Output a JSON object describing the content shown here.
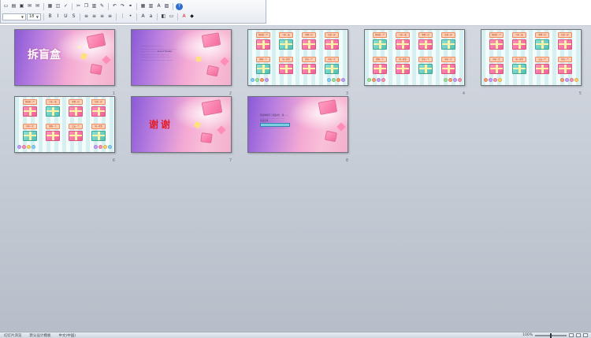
{
  "toolbar": {
    "font_size": "18",
    "row1_icons": [
      "new-icon",
      "open-icon",
      "save-icon",
      "permission-icon",
      "email-icon",
      "print-icon",
      "print-preview-icon",
      "spelling-icon",
      "cut-icon",
      "copy-icon",
      "paste-icon",
      "format-painter-icon",
      "undo-icon",
      "redo-icon",
      "hyperlink-icon",
      "table-icon",
      "chart-icon",
      "text-box-icon",
      "insert-picture-icon",
      "help-icon"
    ],
    "row2_icons": [
      "bold-icon",
      "italic-icon",
      "underline-icon",
      "shadow-icon",
      "align-left-icon",
      "align-center-icon",
      "align-right-icon",
      "justify-icon",
      "numbering-icon",
      "bullets-icon",
      "increase-font-icon",
      "decrease-font-icon",
      "design-icon",
      "new-slide-icon",
      "font-color-icon",
      "fill-color-icon"
    ]
  },
  "slides": [
    {
      "number": "1",
      "title": "拆盲盒"
    },
    {
      "number": "2",
      "lines": [
        "……………………………",
        "………………………………………………",
        "…………………… Sound Trouble",
        "……………………………………",
        "………………………………………",
        "…………………………………………"
      ]
    },
    {
      "number": "3",
      "cards": [
        "咖啡给一个",
        "可乐一瓶",
        "零食一份",
        "奶茶一杯",
        "拥抱一下",
        "唱一首歌",
        "签名一个",
        "再来一次"
      ]
    },
    {
      "number": "4",
      "cards": [
        "咖啡给一个",
        "可乐一瓶",
        "零食一份",
        "奶茶一杯",
        "拥抱一下",
        "唱一首歌",
        "签名一个",
        "再来一次"
      ]
    },
    {
      "number": "5",
      "cards": [
        "咖啡给一个",
        "可乐一瓶",
        "零食一份",
        "奶茶一杯",
        "再来一次",
        "唱一首歌",
        "交友一个",
        "签名一个"
      ]
    },
    {
      "number": "6",
      "cards": [
        "咖啡给一个",
        "可乐一瓶",
        "零食一份",
        "奶茶一杯",
        "再来一次",
        "拥抱一下",
        "交友一个",
        "唱一首歌"
      ]
    },
    {
      "number": "7",
      "title": "谢谢"
    },
    {
      "number": "8",
      "lines": [
        "恭喜你获得了奖品1份，请……",
        "………………………………",
        "获奖名单……………………",
        "…………………………………",
        "……………………………………"
      ]
    }
  ],
  "statusbar": {
    "slide_sorter": "幻灯片浏览",
    "theme": "默认设计模板",
    "language": "中文(中国)",
    "zoom": "100%"
  }
}
